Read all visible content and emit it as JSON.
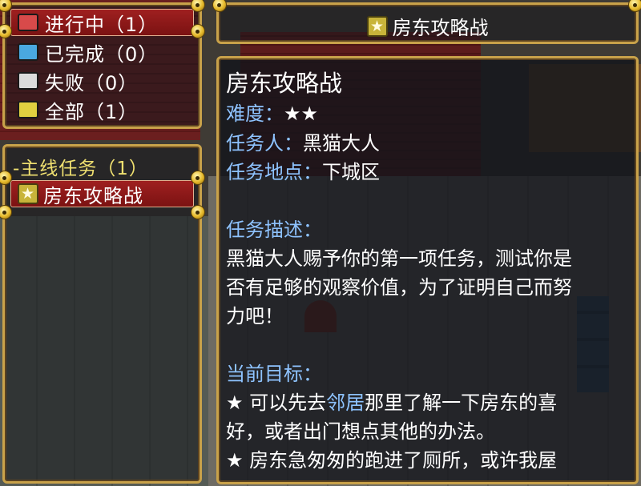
{
  "categories": [
    {
      "label": "进行中（1）",
      "icon_color": "#d84a4a",
      "selected": true
    },
    {
      "label": "已完成（0）",
      "icon_color": "#4aa8e0",
      "selected": false
    },
    {
      "label": "失败（0）",
      "icon_color": "#dcdcdc",
      "selected": false
    },
    {
      "label": "全部（1）",
      "icon_color": "#e0d040",
      "selected": false
    }
  ],
  "quest_list": {
    "group_label": "-主线任务（1）",
    "items": [
      {
        "icon": "star-icon",
        "label": "房东攻略战"
      }
    ]
  },
  "header": {
    "icon": "star-icon",
    "title": "房东攻略战"
  },
  "detail": {
    "title": "房东攻略战",
    "difficulty_label": "难度：",
    "difficulty_value": "★★",
    "giver_label": "任务人：",
    "giver_value": "黑猫大人",
    "location_label": "任务地点：",
    "location_value": "下城区",
    "desc_label": "任务描述：",
    "desc_lines": [
      "黑猫大人赐予你的第一项任务，测试你是",
      "否有足够的观察价值，为了证明自己而努",
      "力吧！"
    ],
    "goal_label": "当前目标：",
    "goal1_a": "★ 可以先去",
    "goal1_link": "邻居",
    "goal1_b": "那里了解一下房东的喜",
    "goal1_line2": "好，或者出门想点其他的办法。",
    "goal2": "★ 房东急匆匆的跑进了厕所，或许我屋"
  },
  "colors": {
    "frame": "#c9a24a",
    "selected": "#a02020",
    "label_blue": "#8ec3ff"
  }
}
